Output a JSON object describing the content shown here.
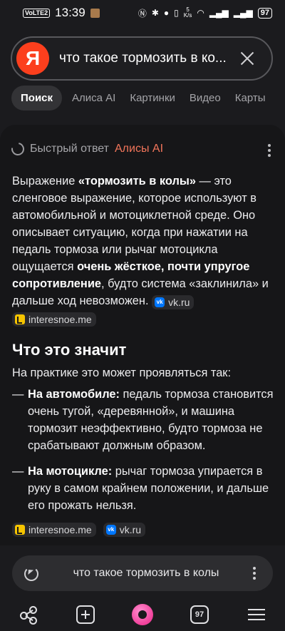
{
  "status": {
    "badge": "VoLTE2",
    "time": "13:39",
    "net": "5",
    "speed_top": "KB",
    "speed_bottom": "K/s",
    "battery": "97"
  },
  "search": {
    "logo_letter": "Я",
    "query": "что такое тормозить в ко..."
  },
  "tabs": [
    {
      "label": "Поиск"
    },
    {
      "label": "Алиса AI"
    },
    {
      "label": "Картинки"
    },
    {
      "label": "Видео"
    },
    {
      "label": "Карты"
    }
  ],
  "answer": {
    "header_prefix": "Быстрый ответ",
    "header_accent": "Алисы AI",
    "p1_a": "Выражение ",
    "p1_b": "«тормозить в колы»",
    "p1_c": " — это сленговое выражение, которое используют в автомобильной и мотоциклетной среде. Оно описывает ситуацию, когда при нажатии на педаль тормоза или рычаг мотоцикла ощущается ",
    "p1_d": "очень жёсткое, почти упругое сопротивление",
    "p1_e": ", будто система «заклинила» и дальше ход невозможен. ",
    "src_vk": "vk.ru",
    "src_ie": "interesnoe.me",
    "heading": "Что это значит",
    "intro": "На практике это может проявляться так:",
    "dash": "—",
    "li1_label": "На автомобиле:",
    "li1_text": " педаль тормоза становится очень тугой, «деревянной», и машина тормозит неэффективно, будто тормоза не срабатывают должным образом.",
    "li2_label": "На мотоцикле:",
    "li2_text": " рычаг тормоза упирается в руку в самом крайнем положении, и дальше его прожать нельзя.",
    "vk_glyph": "vk"
  },
  "bottom_query": "что такое тормозить в колы",
  "nav": {
    "tabs_count": "97"
  }
}
